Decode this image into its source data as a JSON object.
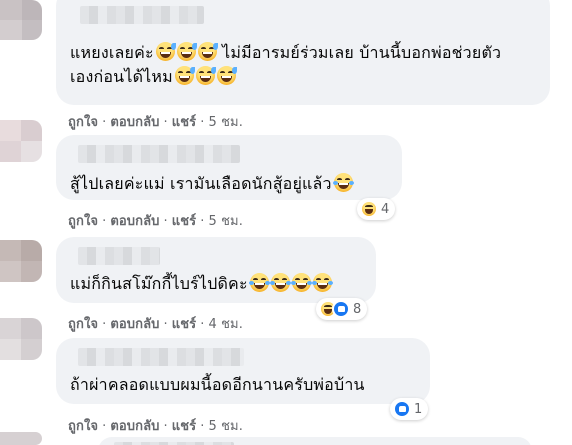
{
  "comments": [
    {
      "text_line1": "แหยงเลยค่ะ",
      "text_line1b": "ไม่มีอารมย์ร่วมเลย บ้านนี้บอกพ่อช่วยตัว",
      "text_line2": "เองก่อนได้ไหม",
      "actions": {
        "like": "ถูกใจ",
        "reply": "ตอบกลับ",
        "share": "แชร์",
        "time": "5 ชม."
      }
    },
    {
      "text_line1": "สู้ไปเลยค่ะแม่ เรามันเลือดนักสู้อยู่แล้ว",
      "reaction_count": "4",
      "actions": {
        "like": "ถูกใจ",
        "reply": "ตอบกลับ",
        "share": "แชร์",
        "time": "5 ชม."
      }
    },
    {
      "text_line1": "แม่ก็กินสโม๊กกี้ไบร์ไปดิคะ",
      "reaction_count": "8",
      "actions": {
        "like": "ถูกใจ",
        "reply": "ตอบกลับ",
        "share": "แชร์",
        "time": "4 ชม."
      }
    },
    {
      "text_line1": "ถ้าผ่าคลอดแบบผมนี้อดอีกนานครับพ่อบ้าน",
      "reaction_count": "1",
      "actions": {
        "like": "ถูกใจ",
        "reply": "ตอบกลับ",
        "share": "แชร์",
        "time": "5 ชม."
      }
    }
  ],
  "colors": {
    "bubble": "#f0f2f5",
    "meta": "#65676b",
    "like_blue": "#1877f2",
    "haha_yellow": "#f7b42c"
  }
}
